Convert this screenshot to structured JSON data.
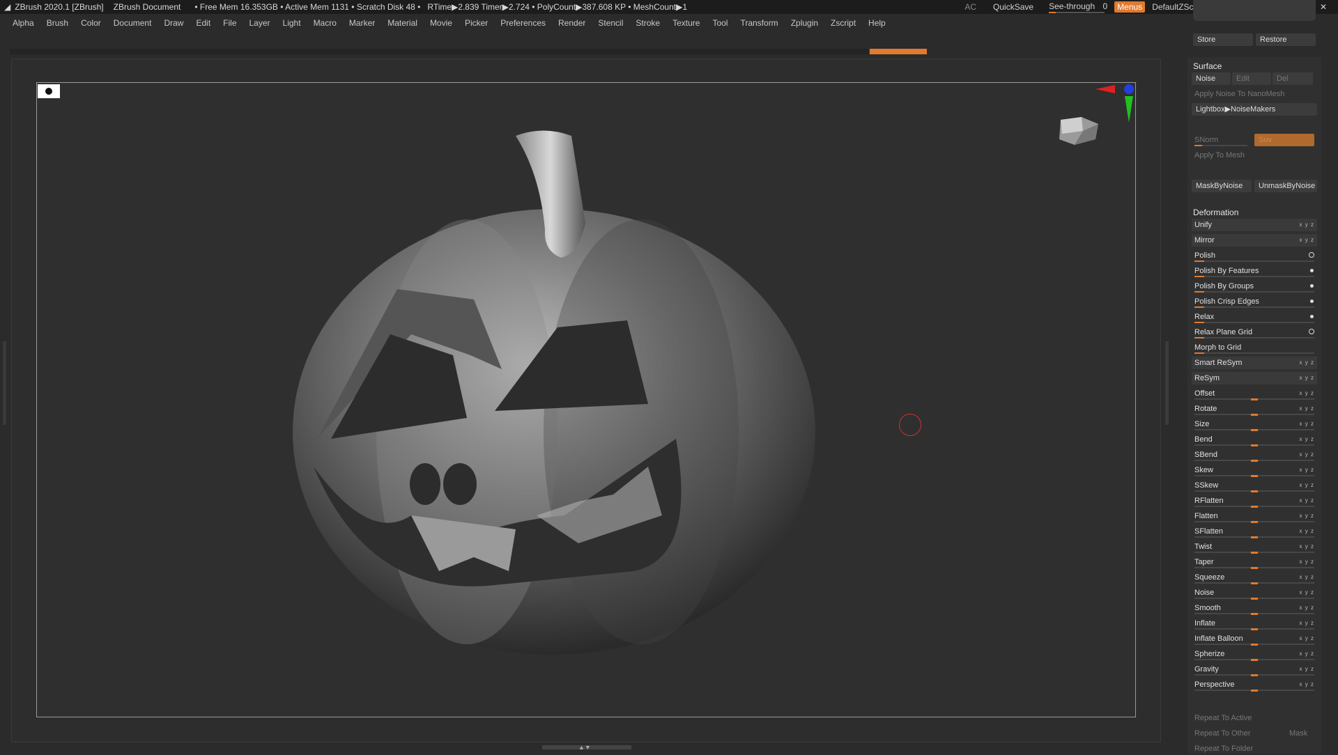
{
  "titlebar": {
    "app": "ZBrush 2020.1 [ZBrush]",
    "doc": "ZBrush Document",
    "stats": "• Free Mem 16.353GB • Active Mem 1131 • Scratch Disk 48 •",
    "rtime": "RTime▶2.839 Timer▶2.724 • PolyCount▶387.608 KP • MeshCount▶1",
    "ac": "AC",
    "quicksave": "QuickSave",
    "seethrough": "See-through",
    "seethrough_value": "0",
    "menus": "Menus",
    "script": "DefaultZScript"
  },
  "menubar": [
    "Alpha",
    "Brush",
    "Color",
    "Document",
    "Draw",
    "Edit",
    "File",
    "Layer",
    "Light",
    "Macro",
    "Marker",
    "Material",
    "Movie",
    "Picker",
    "Preferences",
    "Render",
    "Stencil",
    "Stroke",
    "Texture",
    "Tool",
    "Transform",
    "Zplugin",
    "Zscript",
    "Help"
  ],
  "panel_top": {
    "store": "Store",
    "restore": "Restore"
  },
  "surface": {
    "title": "Surface",
    "noise": "Noise",
    "edit": "Edit",
    "del": "Del",
    "apply_nano": "Apply Noise To NanoMesh",
    "lightbox": "Lightbox▶NoiseMakers",
    "snorm": "SNorm",
    "suv": "Suv",
    "apply_mesh": "Apply To Mesh",
    "mask": "MaskByNoise",
    "unmask": "UnmaskByNoise"
  },
  "deformation": {
    "title": "Deformation",
    "items": [
      {
        "label": "Unify",
        "type": "xyz"
      },
      {
        "label": "Mirror",
        "type": "xyz"
      },
      {
        "label": "Polish",
        "type": "circle",
        "value": 0.08
      },
      {
        "label": "Polish By Features",
        "type": "dot",
        "value": 0.08
      },
      {
        "label": "Polish By Groups",
        "type": "dot",
        "value": 0.08
      },
      {
        "label": "Polish Crisp Edges",
        "type": "dot",
        "value": 0.08
      },
      {
        "label": "Relax",
        "type": "dot",
        "value": 0.08
      },
      {
        "label": "Relax Plane Grid",
        "type": "circle",
        "value": 0.08
      },
      {
        "label": "Morph to Grid",
        "type": "none",
        "value": 0.08
      },
      {
        "label": "Smart ReSym",
        "type": "xyz"
      },
      {
        "label": "ReSym",
        "type": "xyz"
      },
      {
        "label": "Offset",
        "type": "slider",
        "value": 0.5
      },
      {
        "label": "Rotate",
        "type": "slider",
        "value": 0.5
      },
      {
        "label": "Size",
        "type": "slider",
        "value": 0.5
      },
      {
        "label": "Bend",
        "type": "slider",
        "value": 0.5
      },
      {
        "label": "SBend",
        "type": "slider",
        "value": 0.5
      },
      {
        "label": "Skew",
        "type": "slider",
        "value": 0.5
      },
      {
        "label": "SSkew",
        "type": "slider",
        "value": 0.5
      },
      {
        "label": "RFlatten",
        "type": "slider",
        "value": 0.5
      },
      {
        "label": "Flatten",
        "type": "slider",
        "value": 0.5
      },
      {
        "label": "SFlatten",
        "type": "slider",
        "value": 0.5
      },
      {
        "label": "Twist",
        "type": "slider",
        "value": 0.5
      },
      {
        "label": "Taper",
        "type": "slider",
        "value": 0.5
      },
      {
        "label": "Squeeze",
        "type": "slider",
        "value": 0.5
      },
      {
        "label": "Noise",
        "type": "slider",
        "value": 0.5
      },
      {
        "label": "Smooth",
        "type": "slider",
        "value": 0.5
      },
      {
        "label": "Inflate",
        "type": "slider",
        "value": 0.5
      },
      {
        "label": "Inflate Balloon",
        "type": "slider",
        "value": 0.5
      },
      {
        "label": "Spherize",
        "type": "slider",
        "value": 0.5
      },
      {
        "label": "Gravity",
        "type": "slider",
        "value": 0.5
      },
      {
        "label": "Perspective",
        "type": "slider",
        "value": 0.5
      }
    ],
    "repeat_active": "Repeat To Active",
    "repeat_other": "Repeat To Other",
    "mask": "Mask",
    "repeat_folder": "Repeat To Folder"
  },
  "colors": {
    "accent": "#e07a2e",
    "panel": "#303030",
    "bg": "#2b2b2b"
  }
}
